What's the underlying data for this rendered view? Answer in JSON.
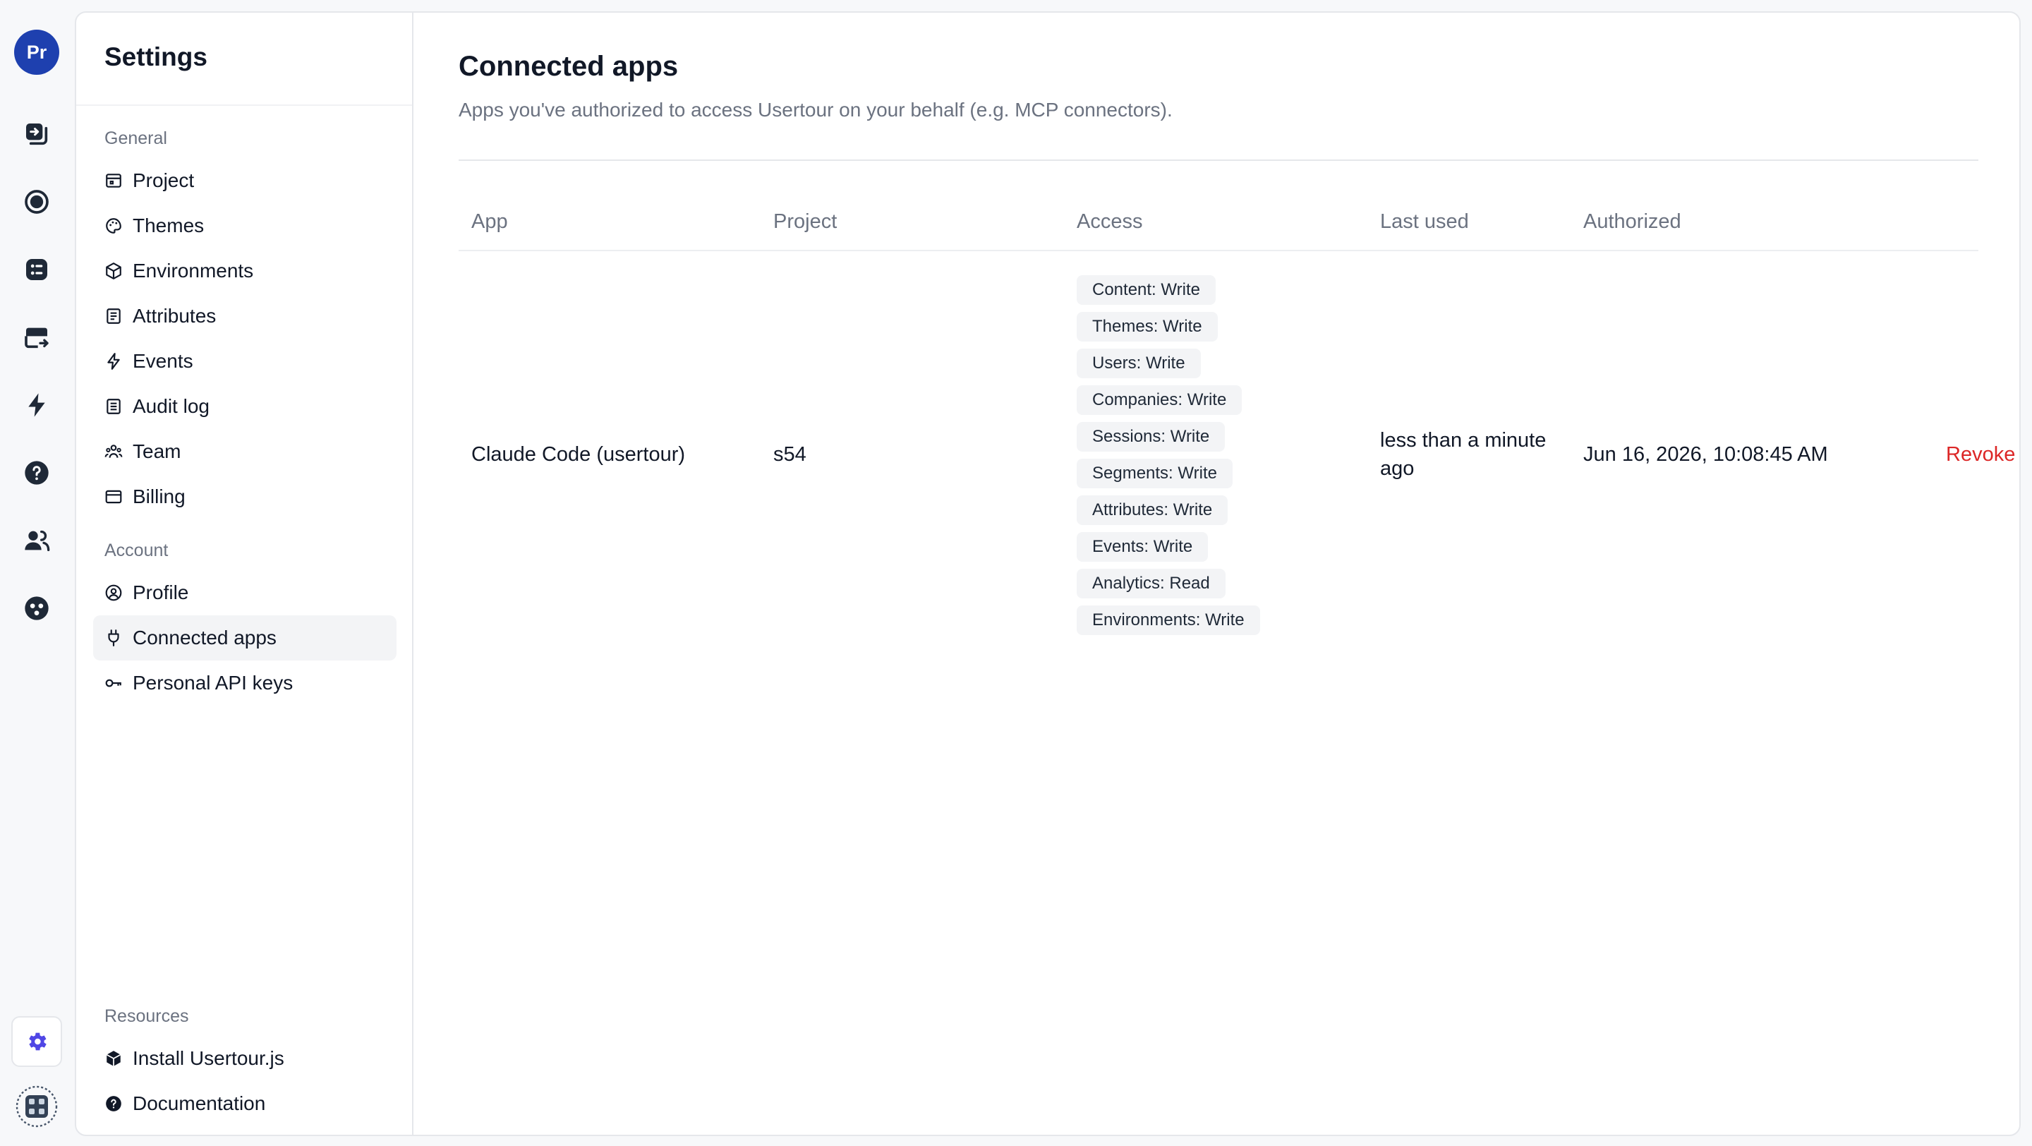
{
  "rail": {
    "avatar_initials": "Pr",
    "icons": [
      "flows-icon",
      "record-icon",
      "checklist-icon",
      "launcher-icon",
      "bolt-icon",
      "help-icon",
      "users-icon",
      "companies-icon"
    ],
    "settings_icon": "gear-icon",
    "accent": "#1e40af",
    "settings_accent": "#4f46e5"
  },
  "sidebar": {
    "title": "Settings",
    "sections": {
      "general": "General",
      "account": "Account",
      "resources": "Resources"
    },
    "general_items": [
      "Project",
      "Themes",
      "Environments",
      "Attributes",
      "Events",
      "Audit log",
      "Team",
      "Billing"
    ],
    "account_items": [
      "Profile",
      "Connected apps",
      "Personal API keys"
    ],
    "resources_items": [
      "Install Usertour.js",
      "Documentation"
    ],
    "active_item": "Connected apps"
  },
  "main": {
    "title": "Connected apps",
    "subtitle": "Apps you've authorized to access Usertour on your behalf (e.g. MCP connectors).",
    "table": {
      "headers": [
        "App",
        "Project",
        "Access",
        "Last used",
        "Authorized"
      ],
      "rows": [
        {
          "app": "Claude Code (usertour)",
          "project": "s54",
          "access": [
            "Content: Write",
            "Themes: Write",
            "Users: Write",
            "Companies: Write",
            "Sessions: Write",
            "Segments: Write",
            "Attributes: Write",
            "Events: Write",
            "Analytics: Read",
            "Environments: Write"
          ],
          "last_used_line1": "less than a minute",
          "last_used_line2": "ago",
          "authorized": "Jun 16, 2026, 10:08:45 AM",
          "action": "Revoke"
        }
      ]
    },
    "revoke_color": "#dc2626"
  }
}
